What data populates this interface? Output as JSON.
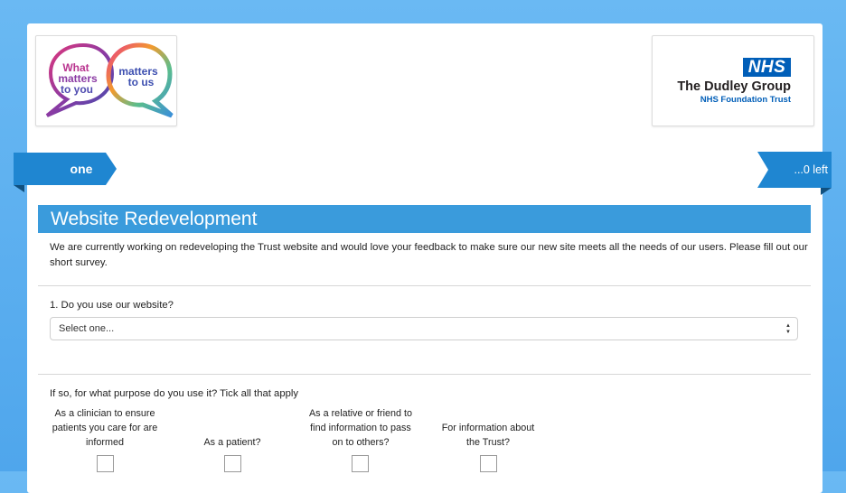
{
  "logo_left": {
    "line1": "What",
    "line2": "matters",
    "line3": "to you",
    "line4": "matters",
    "line5": "to us"
  },
  "logo_right": {
    "badge": "NHS",
    "org_name": "The Dudley Group",
    "org_sub": "NHS Foundation Trust"
  },
  "progress": {
    "current_page": "one",
    "remaining": "...0 left"
  },
  "section": {
    "title": "Website Redevelopment",
    "intro": "We are currently working on redeveloping the Trust website and would love your feedback to make sure our new site meets all the needs of our users. Please fill out our short survey."
  },
  "question1": {
    "label": "1. Do you use our website?",
    "selected": "Select one..."
  },
  "question2": {
    "label": "If so, for what purpose do you use it? Tick all that apply",
    "options": [
      {
        "label": "As a clinician to ensure patients you care for are informed"
      },
      {
        "label": "As a patient?"
      },
      {
        "label": "As a relative or friend to find information to pass on to others?"
      },
      {
        "label": "For information about the Trust?"
      }
    ]
  },
  "colors": {
    "section_bar": "#3a9bdc",
    "ribbon": "#1f86d1",
    "nhs_blue": "#005eb8"
  }
}
